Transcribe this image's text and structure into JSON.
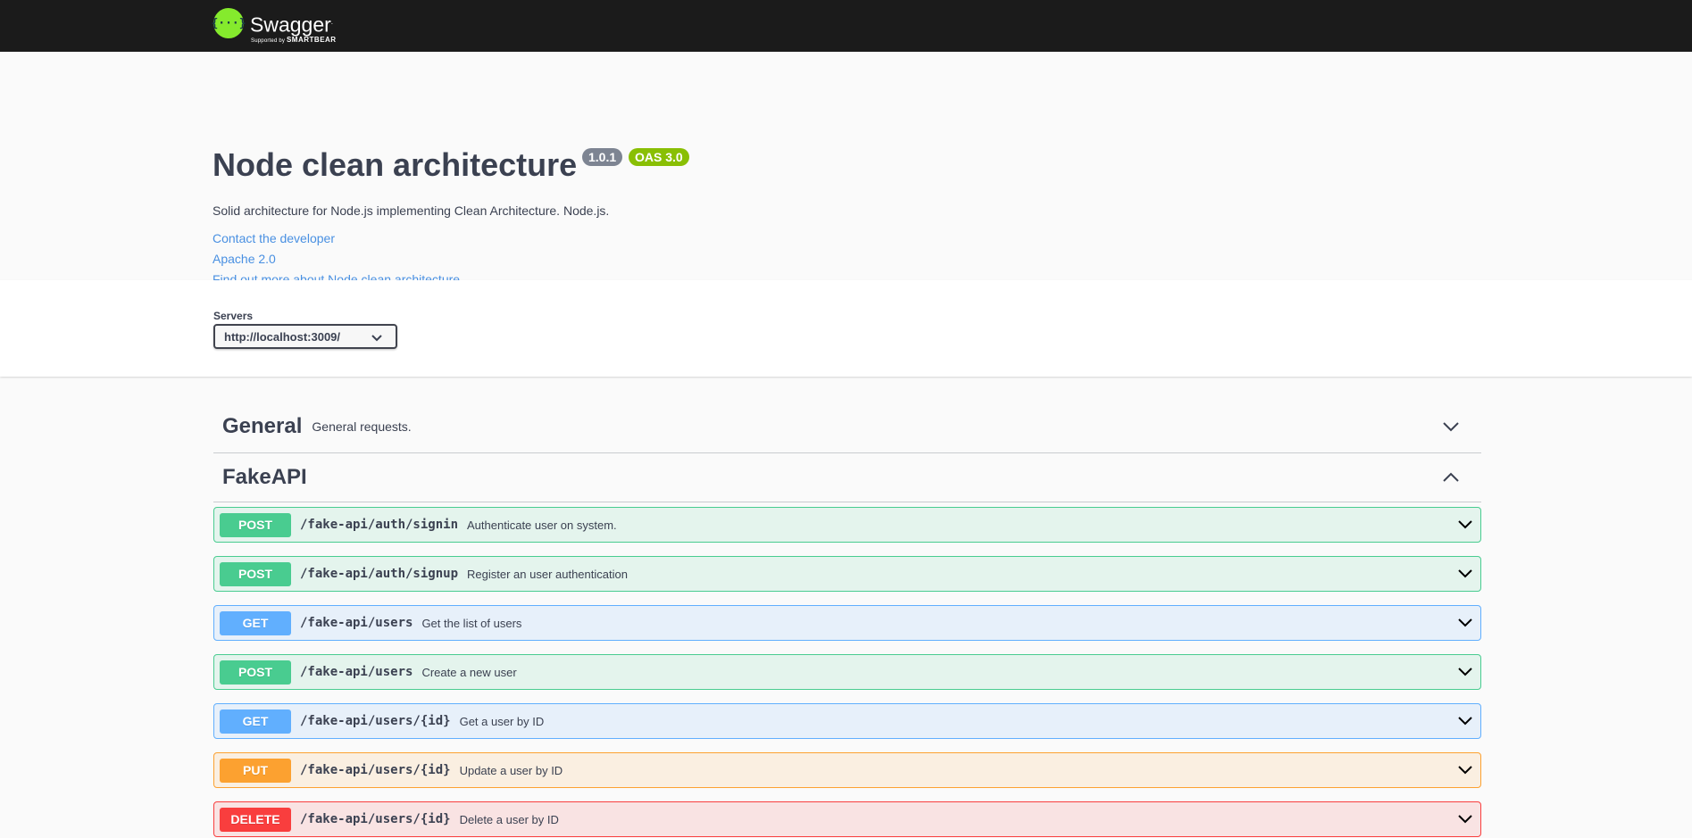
{
  "topbar": {
    "brand": "Swagger",
    "brand_tm": ".",
    "supported_by": "Supported by",
    "smartbear": "SMARTBEAR",
    "logo_glyph": "{···}",
    "logo_icon": "swagger-logo-icon",
    "accent": "#85ea2d"
  },
  "info": {
    "title": "Node clean architecture",
    "version": "1.0.1",
    "oas": "OAS 3.0",
    "description": "Solid architecture for Node.js implementing Clean Architecture. Node.js.",
    "links": {
      "contact": "Contact the developer",
      "license": "Apache 2.0",
      "external_docs": "Find out more about Node clean architecture"
    }
  },
  "servers": {
    "label": "Servers",
    "selected": "http://localhost:3009/"
  },
  "tags": [
    {
      "name": "General",
      "description": "General requests.",
      "expanded": false
    },
    {
      "name": "FakeAPI",
      "description": "",
      "expanded": true
    }
  ],
  "operations": [
    {
      "method": "POST",
      "path": "/fake-api/auth/signin",
      "summary": "Authenticate user on system."
    },
    {
      "method": "POST",
      "path": "/fake-api/auth/signup",
      "summary": "Register an user authentication"
    },
    {
      "method": "GET",
      "path": "/fake-api/users",
      "summary": "Get the list of users"
    },
    {
      "method": "POST",
      "path": "/fake-api/users",
      "summary": "Create a new user"
    },
    {
      "method": "GET",
      "path": "/fake-api/users/{id}",
      "summary": "Get a user by ID"
    },
    {
      "method": "PUT",
      "path": "/fake-api/users/{id}",
      "summary": "Update a user by ID"
    },
    {
      "method": "DELETE",
      "path": "/fake-api/users/{id}",
      "summary": "Delete a user by ID"
    }
  ],
  "colors": {
    "post": "#49cc90",
    "get": "#61affe",
    "put": "#fca130",
    "delete": "#f93e3e",
    "link": "#4990e2"
  }
}
